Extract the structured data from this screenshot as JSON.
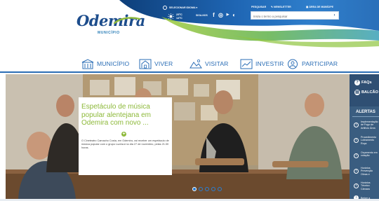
{
  "colors": {
    "brand_blue": "#1d4d8c",
    "nav_blue": "#2a6db5",
    "accent_green": "#8db93a",
    "panel_blue": "#3a5d80"
  },
  "header": {
    "logo_text": "Odemira",
    "logo_subtitle": "MUNICÍPIO",
    "topbar": {
      "language": "SELECIONAR IDIOMA",
      "language_icon": "globe-icon",
      "pesquisar": "PESQUISAR",
      "newsletter": "NEWSLETTER",
      "area_municipe": "ÁREA DE MUNÍCIPE"
    },
    "weather": {
      "icon": "sun-icon",
      "max": "25ºC",
      "min": "14ºC"
    },
    "apps_label": "SIGA-NOS",
    "social_icons": [
      "facebook-icon",
      "instagram-icon",
      "youtube-icon",
      "app-icon"
    ],
    "search": {
      "placeholder": "Insira o termo a pesquisar",
      "icon": "arrow-right-icon"
    }
  },
  "nav": {
    "items": [
      {
        "label": "MUNICÍPIO",
        "icon": "building-icon"
      },
      {
        "label": "VIVER",
        "icon": "house-icon"
      },
      {
        "label": "VISITAR",
        "icon": "landscape-icon"
      },
      {
        "label": "INVESTIR",
        "icon": "chart-icon"
      },
      {
        "label": "PARTICIPAR",
        "icon": "people-icon"
      }
    ]
  },
  "hero": {
    "title": "Espetáculo de música popular alentejana em Odemira com novo ...",
    "text": "O Cineteatro Camacho Costa, em Odemira, vai receber um espetáculo de música popular com o grupo LuzAzul no dia 27 de novembro, pelas 21:30 horas.",
    "slides": 5,
    "active_slide": 1
  },
  "sidebar": {
    "faqs_label": "FAQs",
    "balcao_label": "BALCÃO",
    "alerts_title": "ALERTAS",
    "alerts": [
      "Implementação de Fogo de Artifício Área",
      "Procedimento Loteamento Roça",
      "Orçamento em votação",
      "Horários Prevenção Obras e",
      "Horários Técnico Câmara"
    ],
    "last_alert": "Beber a"
  }
}
